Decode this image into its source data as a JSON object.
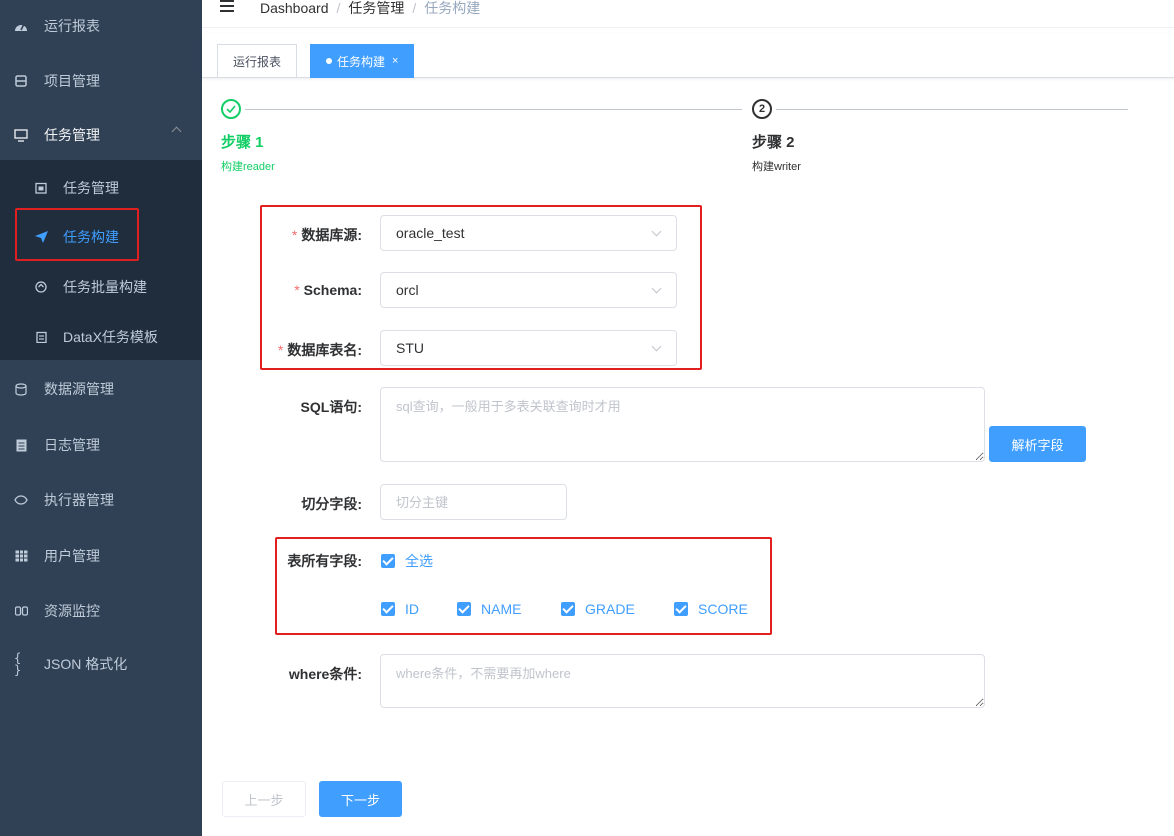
{
  "sidebar": {
    "items": [
      {
        "label": "运行报表",
        "icon": "dashboard-icon"
      },
      {
        "label": "项目管理",
        "icon": "project-icon"
      },
      {
        "label": "任务管理",
        "icon": "monitor-icon"
      },
      {
        "label": "数据源管理",
        "icon": "database-icon"
      },
      {
        "label": "日志管理",
        "icon": "log-icon"
      },
      {
        "label": "执行器管理",
        "icon": "executor-icon"
      },
      {
        "label": "用户管理",
        "icon": "user-grid-icon"
      },
      {
        "label": "资源监控",
        "icon": "monitor-resource-icon"
      },
      {
        "label": "JSON 格式化",
        "icon": "braces-icon"
      }
    ],
    "submenu": [
      {
        "label": "任务管理",
        "icon": "calendar-icon"
      },
      {
        "label": "任务构建",
        "icon": "send-icon",
        "active": true
      },
      {
        "label": "任务批量构建",
        "icon": "batch-icon"
      },
      {
        "label": "DataX任务模板",
        "icon": "template-icon"
      }
    ]
  },
  "breadcrumb": [
    "Dashboard",
    "任务管理",
    "任务构建"
  ],
  "tabs": [
    {
      "label": "运行报表"
    },
    {
      "label": "任务构建",
      "active": true,
      "close": "×"
    }
  ],
  "steps": [
    {
      "title": "步骤 1",
      "desc": "构建reader",
      "status": "done"
    },
    {
      "title": "步骤 2",
      "desc": "构建writer",
      "number": "2",
      "status": "todo"
    }
  ],
  "form": {
    "datasource": {
      "label": "数据库源:",
      "value": "oracle_test"
    },
    "schema": {
      "label": "Schema:",
      "value": "orcl"
    },
    "table": {
      "label": "数据库表名:",
      "value": "STU"
    },
    "sql": {
      "label": "SQL语句:",
      "placeholder": "sql查询，一般用于多表关联查询时才用"
    },
    "parse_button": "解析字段",
    "split": {
      "label": "切分字段:",
      "placeholder": "切分主键"
    },
    "fields": {
      "label": "表所有字段:",
      "select_all": "全选",
      "items": [
        "ID",
        "NAME",
        "GRADE",
        "SCORE"
      ]
    },
    "where": {
      "label": "where条件:",
      "placeholder": "where条件，不需要再加where"
    }
  },
  "buttons": {
    "prev": "上一步",
    "next": "下一步"
  },
  "colors": {
    "primary": "#409eff",
    "success": "#13ce66",
    "sidebar": "#304156",
    "highlight": "#e02020"
  }
}
